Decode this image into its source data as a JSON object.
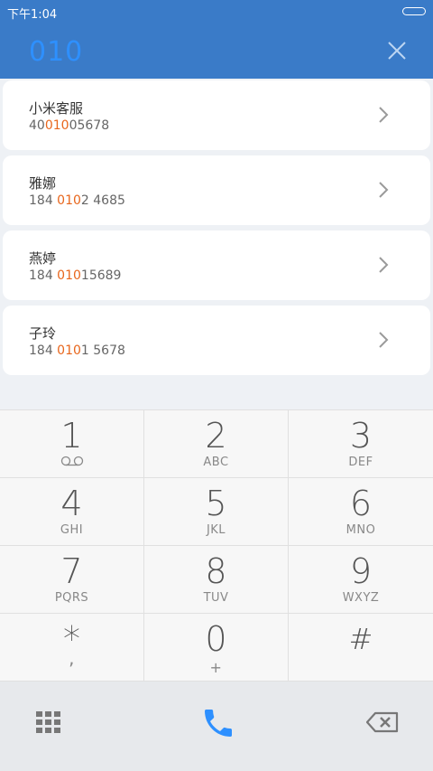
{
  "status_bar": {
    "time": "下午1:04"
  },
  "search": {
    "query": "010"
  },
  "results": [
    {
      "name": "小米客服",
      "number_pre": "40",
      "number_match": "010",
      "number_post": "05678"
    },
    {
      "name": "雅娜",
      "number_pre": "184 ",
      "number_match": "010",
      "number_post": "2 4685"
    },
    {
      "name": "燕婷",
      "number_pre": "184 ",
      "number_match": "010",
      "number_post": "15689"
    },
    {
      "name": "子玲",
      "number_pre": "184 ",
      "number_match": "010",
      "number_post": "1 5678"
    }
  ],
  "keypad": [
    {
      "digit": "1",
      "letters": ""
    },
    {
      "digit": "2",
      "letters": "ABC"
    },
    {
      "digit": "3",
      "letters": "DEF"
    },
    {
      "digit": "4",
      "letters": "GHI"
    },
    {
      "digit": "5",
      "letters": "JKL"
    },
    {
      "digit": "6",
      "letters": "MNO"
    },
    {
      "digit": "7",
      "letters": "PQRS"
    },
    {
      "digit": "8",
      "letters": "TUV"
    },
    {
      "digit": "9",
      "letters": "WXYZ"
    },
    {
      "digit": "*",
      "letters": ","
    },
    {
      "digit": "0",
      "letters": "+"
    },
    {
      "digit": "#",
      "letters": ""
    }
  ],
  "colors": {
    "header": "#3a7bc8",
    "query": "#2e90ff",
    "match_highlight": "#e8661c",
    "call_icon": "#2e90ff"
  },
  "icons": {
    "close": "close-icon",
    "chevron": "chevron-right-icon",
    "voicemail": "voicemail-icon",
    "dialpad": "dialpad-grid-icon",
    "call": "phone-icon",
    "backspace": "backspace-icon"
  }
}
